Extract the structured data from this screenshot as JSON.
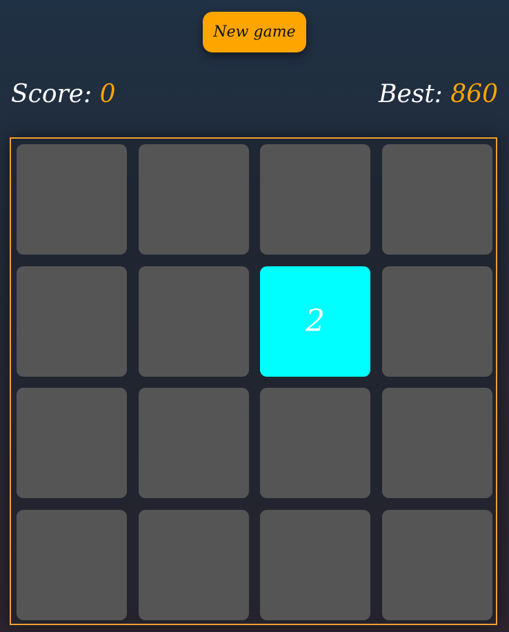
{
  "header": {
    "new_game_label": "New game"
  },
  "score": {
    "label": "Score:",
    "value": "0"
  },
  "best": {
    "label": "Best:",
    "value": "860"
  },
  "board": {
    "size": 4,
    "tiles": [
      [
        "",
        "",
        "",
        ""
      ],
      [
        "",
        "",
        "2",
        ""
      ],
      [
        "",
        "",
        "",
        ""
      ],
      [
        "",
        "",
        "",
        ""
      ]
    ]
  },
  "colors": {
    "accent": "#ffa500",
    "empty_tile": "#555555",
    "tile_2": "#00ffff",
    "tile_text": "#ffffff",
    "board_border": "#f0a030"
  }
}
